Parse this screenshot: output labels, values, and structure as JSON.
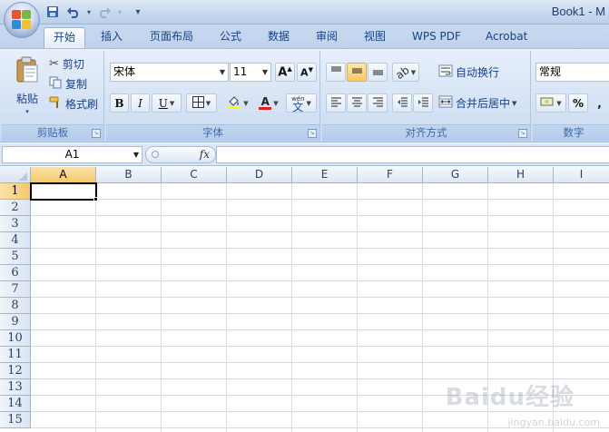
{
  "window": {
    "title": "Book1 - M"
  },
  "qat": {
    "save_icon": "save-icon",
    "undo_icon": "undo-icon",
    "redo_icon": "redo-icon",
    "customize": "▾"
  },
  "tabs": [
    {
      "label": "开始",
      "active": true
    },
    {
      "label": "插入"
    },
    {
      "label": "页面布局"
    },
    {
      "label": "公式"
    },
    {
      "label": "数据"
    },
    {
      "label": "审阅"
    },
    {
      "label": "视图"
    },
    {
      "label": "WPS PDF"
    },
    {
      "label": "Acrobat"
    }
  ],
  "clipboard": {
    "group_label": "剪贴板",
    "paste": "粘贴",
    "cut": "剪切",
    "copy": "复制",
    "format_painter": "格式刷"
  },
  "font": {
    "group_label": "字体",
    "font_name": "宋体",
    "font_size": "11",
    "bold": "B",
    "italic": "I",
    "underline": "U",
    "font_color_letter": "A",
    "phonetic": "wén"
  },
  "alignment": {
    "group_label": "对齐方式",
    "wrap_text": "自动换行",
    "merge_center": "合并后居中"
  },
  "number": {
    "group_label": "数字",
    "format": "常规",
    "percent": "%"
  },
  "formula_bar": {
    "name_box": "A1",
    "fx": "fx",
    "value": ""
  },
  "grid": {
    "columns": [
      "A",
      "B",
      "C",
      "D",
      "E",
      "F",
      "G",
      "H",
      "I"
    ],
    "rows": [
      "1",
      "2",
      "3",
      "4",
      "5",
      "6",
      "7",
      "8",
      "9",
      "10",
      "11",
      "12",
      "13",
      "14",
      "15"
    ],
    "selected_cell": "A1"
  },
  "watermark": {
    "text": "Baidu经验",
    "sub": "jingyan.baidu.com"
  },
  "colors": {
    "accent_selection": "#f5c86b",
    "ribbon_text": "#15428b"
  }
}
